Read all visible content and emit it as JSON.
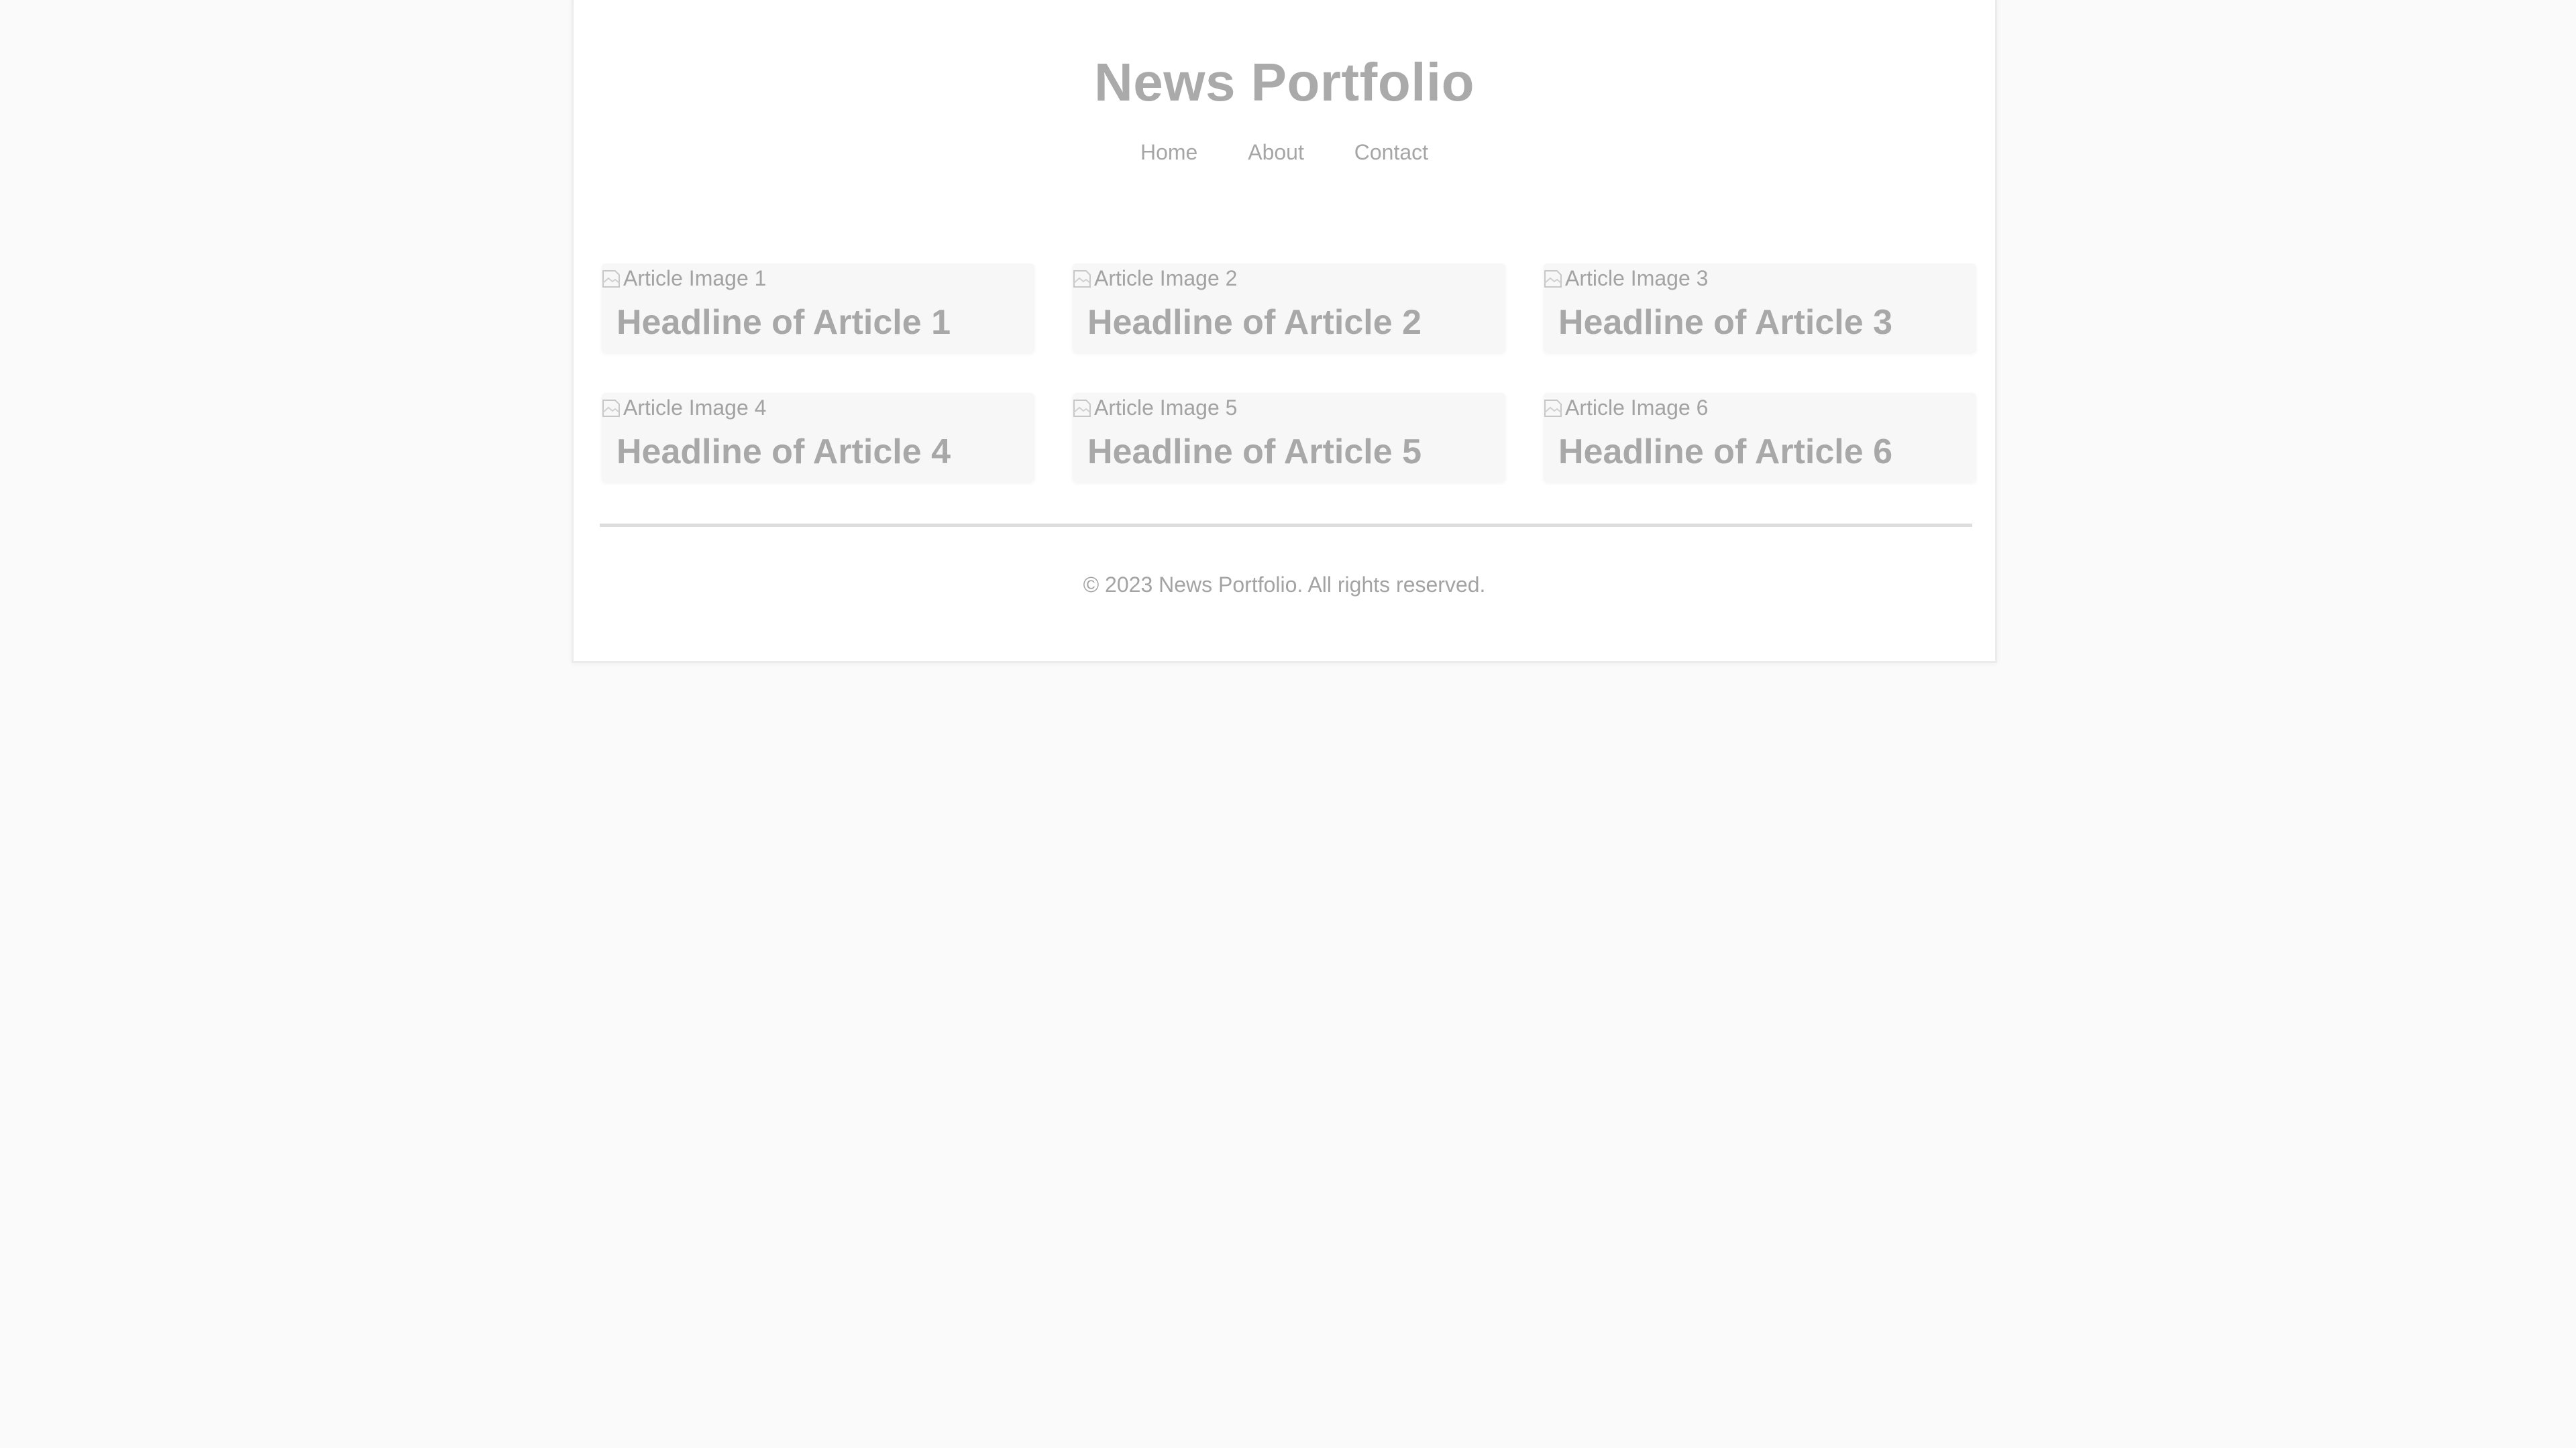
{
  "site": {
    "title": "News Portfolio"
  },
  "nav": {
    "items": [
      "Home",
      "About",
      "Contact"
    ]
  },
  "articles": [
    {
      "image_alt": "Article Image 1",
      "headline": "Headline of Article 1"
    },
    {
      "image_alt": "Article Image 2",
      "headline": "Headline of Article 2"
    },
    {
      "image_alt": "Article Image 3",
      "headline": "Headline of Article 3"
    },
    {
      "image_alt": "Article Image 4",
      "headline": "Headline of Article 4"
    },
    {
      "image_alt": "Article Image 5",
      "headline": "Headline of Article 5"
    },
    {
      "image_alt": "Article Image 6",
      "headline": "Headline of Article 6"
    }
  ],
  "footer": {
    "text": "© 2023 News Portfolio. All rights reserved."
  },
  "colors": {
    "background": "#fafafa",
    "panel": "#ffffff",
    "card": "#f7f7f7",
    "text": "#a8a8a8"
  },
  "icons": {
    "article_image": "broken-image-icon"
  }
}
